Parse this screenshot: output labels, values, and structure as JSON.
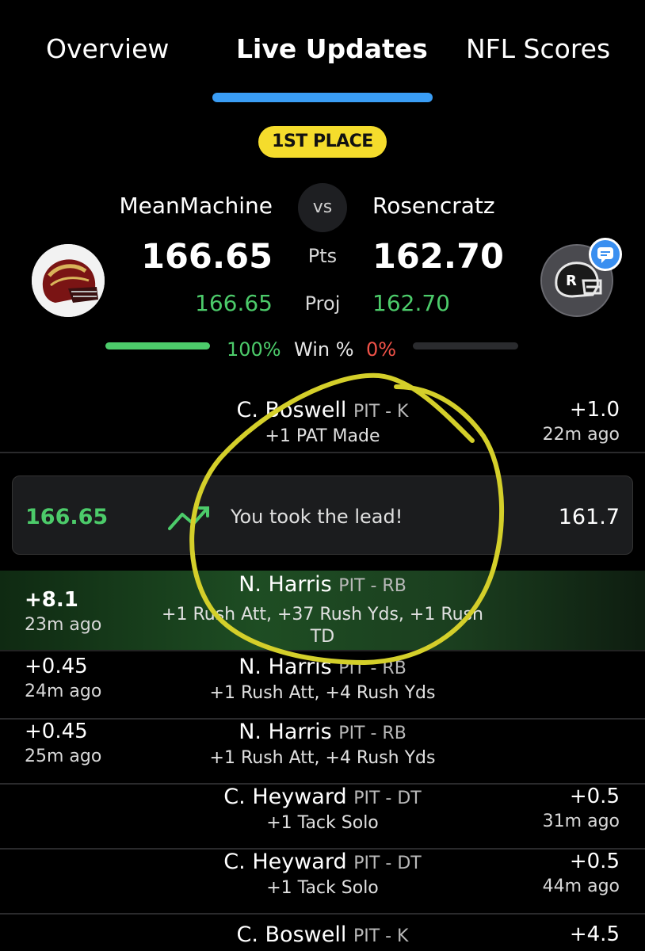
{
  "tabs": [
    {
      "label": "Overview"
    },
    {
      "label": "Live Updates",
      "active": true
    },
    {
      "label": "NFL Scores"
    }
  ],
  "badge": "1ST PLACE",
  "matchup": {
    "left": {
      "name": "MeanMachine",
      "points": "166.65",
      "projected": "166.65",
      "win_pct": "100%"
    },
    "right": {
      "name": "Rosencratz",
      "points": "162.70",
      "projected": "162.70",
      "win_pct": "0%"
    },
    "vs_label": "vs",
    "pts_label": "Pts",
    "proj_label": "Proj",
    "win_label": "Win %",
    "win_probability_left": 1.0
  },
  "updates": [
    {
      "player": "C. Boswell",
      "team_pos": "PIT - K",
      "stats": "+1 PAT Made",
      "points": "+1.0",
      "time": "22m ago",
      "side": "right"
    },
    {
      "player": "N. Harris",
      "team_pos": "PIT - RB",
      "stats": "+1 Rush Att, +37 Rush Yds, +1 Rush TD",
      "points": "+8.1",
      "time": "23m ago",
      "side": "left",
      "highlight": true
    },
    {
      "player": "N. Harris",
      "team_pos": "PIT - RB",
      "stats": "+1 Rush Att, +4 Rush Yds",
      "points": "+0.45",
      "time": "24m ago",
      "side": "left"
    },
    {
      "player": "N. Harris",
      "team_pos": "PIT - RB",
      "stats": "+1 Rush Att, +4 Rush Yds",
      "points": "+0.45",
      "time": "25m ago",
      "side": "left"
    },
    {
      "player": "C. Heyward",
      "team_pos": "PIT - DT",
      "stats": "+1 Tack Solo",
      "points": "+0.5",
      "time": "31m ago",
      "side": "right"
    },
    {
      "player": "C. Heyward",
      "team_pos": "PIT - DT",
      "stats": "+1 Tack Solo",
      "points": "+0.5",
      "time": "44m ago",
      "side": "right"
    },
    {
      "player": "C. Boswell",
      "team_pos": "PIT - K",
      "stats": "",
      "points": "+4.5",
      "time": "",
      "side": "right"
    }
  ],
  "lead_event": {
    "left_score": "166.65",
    "message": "You took the lead!",
    "right_score": "161.7"
  },
  "colors": {
    "accent_blue": "#3a9df5",
    "badge_yellow": "#f5dc2c",
    "positive_green": "#4ccb6a",
    "negative_red": "#f05248",
    "annotation": "#d4cf2a"
  },
  "icons": [
    "team-helmet-avatar",
    "team-logo-avatar",
    "chat-bubble-icon",
    "trend-up-icon"
  ]
}
